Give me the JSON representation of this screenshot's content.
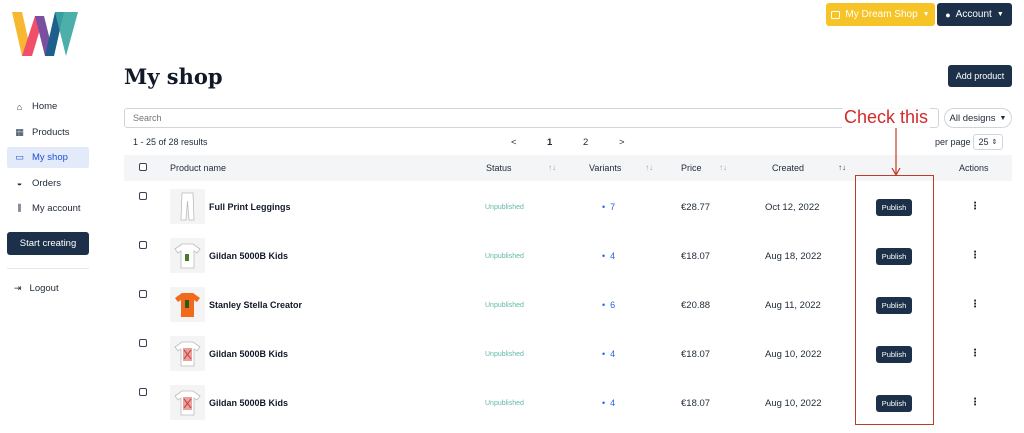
{
  "header": {
    "shop_label": "My Dream Shop",
    "account_label": "Account"
  },
  "sidebar": {
    "items": [
      {
        "label": "Home",
        "icon": "home-icon"
      },
      {
        "label": "Products",
        "icon": "grid-icon"
      },
      {
        "label": "My shop",
        "icon": "store-icon",
        "active": true
      },
      {
        "label": "Orders",
        "icon": "basket-icon"
      },
      {
        "label": "My account",
        "icon": "sliders-icon"
      }
    ],
    "start_label": "Start creating",
    "logout_label": "Logout"
  },
  "main": {
    "title": "My shop",
    "add_label": "Add product",
    "search_placeholder": "Search",
    "designs_label": "All designs",
    "results_text": "1 - 25 of 28 results",
    "pager": {
      "prev": "<",
      "page1": "1",
      "page2": "2",
      "next": ">"
    },
    "perpage_label": "per page",
    "perpage_value": "25"
  },
  "annotation": {
    "text": "Check this"
  },
  "table": {
    "headers": {
      "product": "Product name",
      "status": "Status",
      "variants": "Variants",
      "price": "Price",
      "created": "Created",
      "actions": "Actions"
    },
    "rows": [
      {
        "name": "Full Print Leggings",
        "status": "Unpublished",
        "variants": "7",
        "price": "€28.77",
        "created": "Oct 12, 2022",
        "action": "Publish",
        "thumb": "leggings"
      },
      {
        "name": "Gildan 5000B Kids",
        "status": "Unpublished",
        "variants": "4",
        "price": "€18.07",
        "created": "Aug 18, 2022",
        "action": "Publish",
        "thumb": "white-tee"
      },
      {
        "name": "Stanley Stella Creator",
        "status": "Unpublished",
        "variants": "6",
        "price": "€20.88",
        "created": "Aug 11, 2022",
        "action": "Publish",
        "thumb": "orange-tee"
      },
      {
        "name": "Gildan 5000B Kids",
        "status": "Unpublished",
        "variants": "4",
        "price": "€18.07",
        "created": "Aug 10, 2022",
        "action": "Publish",
        "thumb": "print-tee"
      },
      {
        "name": "Gildan 5000B Kids",
        "status": "Unpublished",
        "variants": "4",
        "price": "€18.07",
        "created": "Aug 10, 2022",
        "action": "Publish",
        "thumb": "print-tee"
      }
    ]
  },
  "colors": {
    "navy": "#1c3149",
    "yellow": "#f7c428",
    "annotation": "#c0392b",
    "status": "#5fb9a8",
    "link": "#2563eb"
  }
}
